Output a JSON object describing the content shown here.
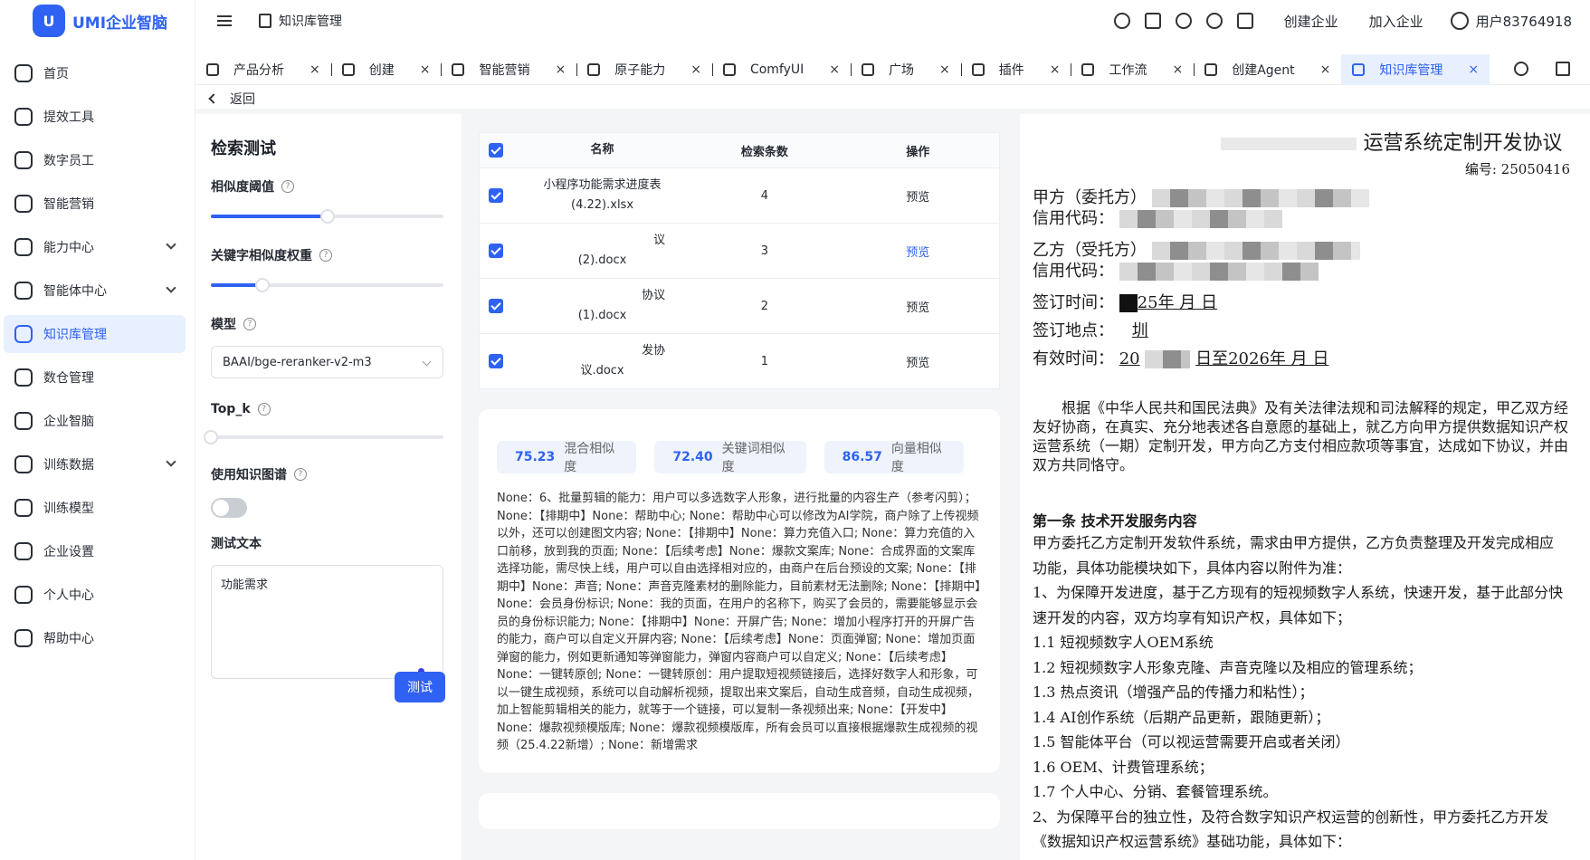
{
  "app": {
    "logo_text": "UMI企业智脑",
    "logo_mark": "U"
  },
  "sidebar": {
    "items": [
      {
        "label": "首页",
        "icon": "home-icon",
        "expandable": false,
        "active": false
      },
      {
        "label": "提效工具",
        "icon": "tools-icon",
        "expandable": false,
        "active": false
      },
      {
        "label": "数字员工",
        "icon": "digital-staff-icon",
        "expandable": false,
        "active": false
      },
      {
        "label": "智能营销",
        "icon": "target-icon",
        "expandable": false,
        "active": false
      },
      {
        "label": "能力中心",
        "icon": "ability-icon",
        "expandable": true,
        "active": false
      },
      {
        "label": "智能体中心",
        "icon": "agent-icon",
        "expandable": true,
        "active": false
      },
      {
        "label": "知识库管理",
        "icon": "book-icon",
        "expandable": false,
        "active": true
      },
      {
        "label": "数仓管理",
        "icon": "warehouse-icon",
        "expandable": false,
        "active": false
      },
      {
        "label": "企业智脑",
        "icon": "brain-icon",
        "expandable": false,
        "active": false
      },
      {
        "label": "训练数据",
        "icon": "data-icon",
        "expandable": true,
        "active": false
      },
      {
        "label": "训练模型",
        "icon": "model-icon",
        "expandable": false,
        "active": false
      },
      {
        "label": "企业设置",
        "icon": "settings-icon",
        "expandable": false,
        "active": false
      },
      {
        "label": "个人中心",
        "icon": "user-icon",
        "expandable": false,
        "active": false
      },
      {
        "label": "帮助中心",
        "icon": "help-icon",
        "expandable": false,
        "active": false
      }
    ]
  },
  "header": {
    "breadcrumb": "知识库管理",
    "create_company": "创建企业",
    "join_company": "加入企业",
    "user": "用户83764918"
  },
  "tabs": [
    {
      "label": "产品分析",
      "active": false
    },
    {
      "label": "创建",
      "active": false
    },
    {
      "label": "智能营销",
      "active": false
    },
    {
      "label": "原子能力",
      "active": false
    },
    {
      "label": "ComfyUI",
      "active": false
    },
    {
      "label": "广场",
      "active": false
    },
    {
      "label": "插件",
      "active": false
    },
    {
      "label": "工作流",
      "active": false
    },
    {
      "label": "创建Agent",
      "active": false
    },
    {
      "label": "知识库管理",
      "active": true
    }
  ],
  "tab_close_glyph": "×",
  "back_label": "返回",
  "search_test": {
    "title": "检索测试",
    "similarity_label": "相似度阈值",
    "similarity_value": 0.5,
    "keyword_weight_label": "关键字相似度权重",
    "keyword_weight_value": 0.22,
    "model_label": "模型",
    "model_value": "BAAI/bge-reranker-v2-m3",
    "topk_label": "Top_k",
    "topk_value": 0.0,
    "use_graph_label": "使用知识图谱",
    "use_graph_on": false,
    "test_text_label": "测试文本",
    "test_text_value": "功能需求",
    "test_button": "测试"
  },
  "results_table": {
    "headers": {
      "name": "名称",
      "count": "检索条数",
      "op": "操作"
    },
    "rows": [
      {
        "name_line1": "小程序功能需求进度表",
        "name_line2": "(4.22).xlsx",
        "count": "4",
        "op": "预览",
        "highlight": false
      },
      {
        "name_line1": "议",
        "name_line2": "(2).docx",
        "count": "3",
        "op": "预览",
        "highlight": true
      },
      {
        "name_line1": "协议",
        "name_line2": "(1).docx",
        "count": "2",
        "op": "预览",
        "highlight": false
      },
      {
        "name_line1": "发协",
        "name_line2": "议.docx",
        "count": "1",
        "op": "预览",
        "highlight": false
      }
    ]
  },
  "scores": [
    {
      "value": "75.23",
      "label": "混合相似度"
    },
    {
      "value": "72.40",
      "label": "关键词相似度"
    },
    {
      "value": "86.57",
      "label": "向量相似度"
    }
  ],
  "result_text": "None：6、批量剪辑的能力：用户可以多选数字人形象，进行批量的内容生产（参考闪剪）；None：【排期中】None：帮助中心; None：帮助中心可以修改为AI学院，商户除了上传视频以外，还可以创建图文内容; None：【排期中】None：算力充值入口; None：算力充值的入口前移，放到我的页面; None：【后续考虑】None：爆款文案库; None：合成界面的文案库选择功能，需尽快上线，用户可以自由选择相对应的，由商户在后台预设的文案; None：【排期中】None：声音; None：声音克隆素材的删除能力，目前素材无法删除; None：【排期中】None：会员身份标识; None：我的页面，在用户的名称下，购买了会员的，需要能够显示会员的身份标识能力; None：【排期中】None：开屏广告; None：增加小程序打开的开屏广告的能力，商户可以自定义开屏内容; None：【后续考虑】None：页面弹窗; None：增加页面弹窗的能力，例如更新通知等弹窗能力，弹窗内容商户可以自定义; None：【后续考虑】None：一键转原创; None：一键转原创：用户提取短视频链接后，选择好数字人和形象，可以一键生成视频，系统可以自动解析视频，提取出来文案后，自动生成音频，自动生成视频，加上智能剪辑相关的能力，就等于一个链接，可以复制一条视频出来; None：【开发中】None：爆款视频模版库; None：爆款视频模版库，所有会员可以直接根据爆款生成视频的视频（25.4.22新增）; None：新增需求",
  "document": {
    "title": "运营系统定制开发协议",
    "number": "编号: 25050416",
    "party_a": "甲方（委托方）",
    "credit_code": "信用代码：",
    "party_b": "乙方（受托方）",
    "sign_time": "签订时间：",
    "sign_time_value": "25年 月 日",
    "sign_place": "签订地点：",
    "sign_place_value": "圳",
    "valid_time": "有效时间：",
    "valid_time_prefix": "20",
    "valid_time_value": "日至2026年 月 日",
    "intro": "根据《中华人民共和国民法典》及有关法律法规和司法解释的规定，甲乙双方经友好协商，在真实、充分地表述各自意愿的基础上，就乙方向甲方提供数据知识产权运营系统（一期）定制开发，甲方向乙方支付相应款项等事宜，达成如下协议，并由双方共同恪守。",
    "section_title": "第一条 技术开发服务内容",
    "body_lines": [
      "甲方委托乙方定制开发软件系统，需求由甲方提供，乙方负责整理及开发完成相应",
      "功能，具体功能模块如下，具体内容以附件为准：",
      "1、为保障开发进度，基于乙方现有的短视频数字人系统，快速开发，基于此部分快",
      "速开发的内容，双方均享有知识产权，具体如下；",
      "1.1 短视频数字人OEM系统",
      "1.2 短视频数字人形象克隆、声音克隆以及相应的管理系统；",
      "1.3 热点资讯（增强产品的传播力和粘性）；",
      "1.4 AI创作系统（后期产品更新，跟随更新）；",
      "1.5 智能体平台（可以视运营需要开启或者关闭）",
      "1.6 OEM、计费管理系统；",
      "1.7 个人中心、分销、套餐管理系统。",
      "2、为保障平台的独立性，及符合数字知识产权运营的创新性，甲方委托乙方开发",
      "《数据知识产权运营系统》基础功能，具体如下："
    ]
  },
  "colors": {
    "accent": "#2f62f2",
    "active_bg": "#e8efff",
    "page_bg": "#f4f5f7"
  }
}
